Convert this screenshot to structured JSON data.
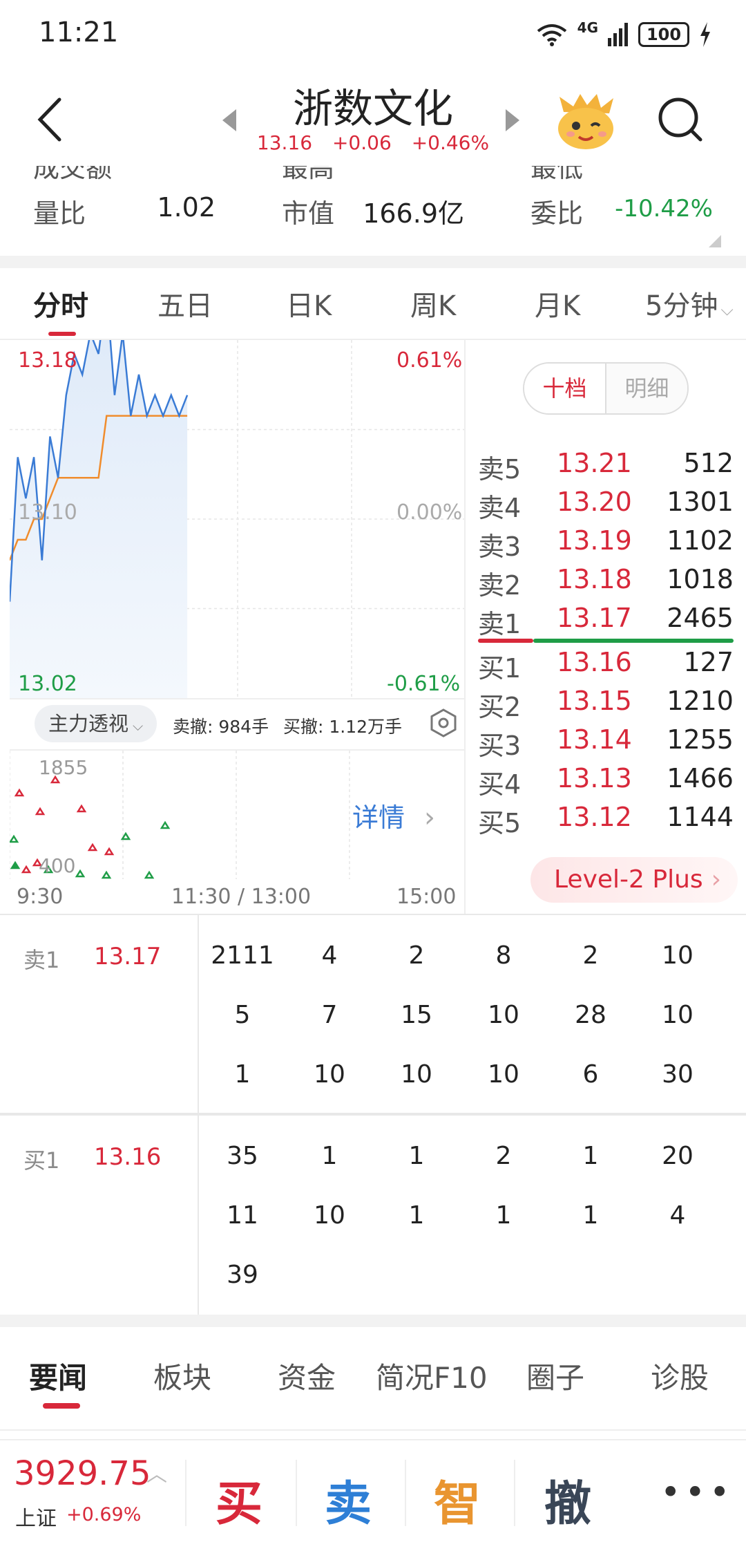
{
  "status": {
    "time": "11:21",
    "network": "4G",
    "battery": "100"
  },
  "header": {
    "name": "浙数文化",
    "price": "13.16",
    "change": "+0.06",
    "change_pct": "+0.46%"
  },
  "stats": {
    "partial_labels": [
      "成交额",
      "最高",
      "最低"
    ],
    "row": [
      {
        "label": "量比",
        "value": "1.02"
      },
      {
        "label": "市值",
        "value": "166.9亿"
      },
      {
        "label": "委比",
        "value": "-10.42%"
      }
    ]
  },
  "tabs": [
    "分时",
    "五日",
    "日K",
    "周K",
    "月K",
    "5分钟"
  ],
  "chart": {
    "price_high": "13.18",
    "price_mid": "13.10",
    "price_low": "13.02",
    "pct_high": "0.61%",
    "pct_mid": "0.00%",
    "pct_low": "-0.61%",
    "zhuli_label": "主力透视",
    "sell_cancel": "卖撤: 984手",
    "buy_cancel": "买撤: 1.12万手",
    "vol_top": "1855",
    "vol_bottom": "400",
    "detail_label": "详情",
    "times": [
      "9:30",
      "11:30 / 13:00",
      "15:00"
    ]
  },
  "chart_data": {
    "type": "line",
    "x": [
      "9:30",
      "9:35",
      "9:40",
      "9:45",
      "9:50",
      "9:55",
      "10:00",
      "10:05",
      "10:10",
      "10:15",
      "10:20",
      "10:25",
      "10:30",
      "10:35",
      "10:40",
      "10:45",
      "10:50",
      "10:55",
      "11:00",
      "11:05",
      "11:10",
      "11:15",
      "11:20"
    ],
    "series": [
      {
        "values": [
          13.06,
          13.13,
          13.11,
          13.13,
          13.08,
          13.14,
          13.12,
          13.16,
          13.18,
          13.17,
          13.19,
          13.18,
          13.21,
          13.16,
          13.19,
          13.15,
          13.17,
          13.15,
          13.16,
          13.15,
          13.16,
          13.15,
          13.16
        ]
      },
      {
        "values": [
          13.08,
          13.09,
          13.09,
          13.1,
          13.1,
          13.11,
          13.12,
          13.12,
          13.12,
          13.12,
          13.12,
          13.12,
          13.15,
          13.15,
          13.15,
          13.15,
          13.15,
          13.15,
          13.15,
          13.15,
          13.15,
          13.15,
          13.15
        ]
      }
    ],
    "ylim": [
      13.02,
      13.18
    ],
    "xlabel": "",
    "ylabel": "",
    "grid": true
  },
  "orderbook": {
    "toggle": [
      "十档",
      "明细"
    ],
    "sell": [
      {
        "label": "卖5",
        "price": "13.21",
        "qty": "512"
      },
      {
        "label": "卖4",
        "price": "13.20",
        "qty": "1301"
      },
      {
        "label": "卖3",
        "price": "13.19",
        "qty": "1102"
      },
      {
        "label": "卖2",
        "price": "13.18",
        "qty": "1018"
      },
      {
        "label": "卖1",
        "price": "13.17",
        "qty": "2465"
      }
    ],
    "buy": [
      {
        "label": "买1",
        "price": "13.16",
        "qty": "127"
      },
      {
        "label": "买2",
        "price": "13.15",
        "qty": "1210"
      },
      {
        "label": "买3",
        "price": "13.14",
        "qty": "1255"
      },
      {
        "label": "买4",
        "price": "13.13",
        "qty": "1466"
      },
      {
        "label": "买5",
        "price": "13.12",
        "qty": "1144"
      }
    ],
    "level2": "Level-2 Plus"
  },
  "queues": {
    "sell": {
      "label": "卖1",
      "price": "13.17",
      "cells": [
        "2111",
        "4",
        "2",
        "8",
        "2",
        "10",
        "5",
        "7",
        "15",
        "10",
        "28",
        "10",
        "1",
        "10",
        "10",
        "10",
        "6",
        "30"
      ]
    },
    "buy": {
      "label": "买1",
      "price": "13.16",
      "cells": [
        "35",
        "1",
        "1",
        "2",
        "1",
        "20",
        "11",
        "10",
        "1",
        "1",
        "1",
        "4",
        "39"
      ]
    }
  },
  "news_tabs": [
    "要闻",
    "板块",
    "资金",
    "简况F10",
    "圈子",
    "诊股"
  ],
  "bottom": {
    "index_value": "3929.75",
    "index_name": "上证",
    "index_change": "+0.69%",
    "buy": "买",
    "sell": "卖",
    "smart": "智",
    "cancel": "撤",
    "more": "•••"
  },
  "colors": {
    "up": "#d8283a",
    "down": "#1f9d47",
    "price_line": "#3a7bd5",
    "avg_line": "#f08c2c"
  }
}
